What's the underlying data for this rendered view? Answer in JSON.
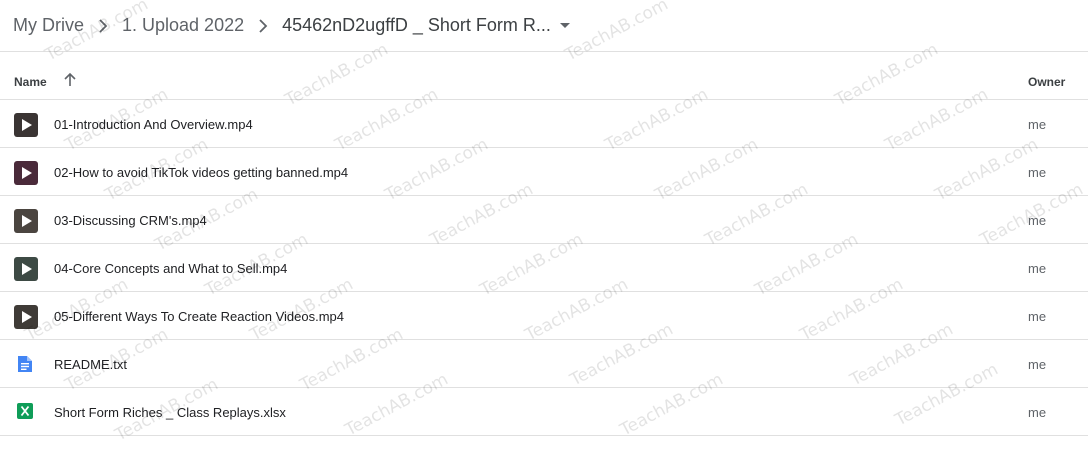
{
  "breadcrumb": {
    "root": "My Drive",
    "level1": "1. Upload 2022",
    "current": "45462nD2ugffD _ Short Form R..."
  },
  "columns": {
    "name": "Name",
    "owner": "Owner"
  },
  "files": [
    {
      "name": "01-Introduction And Overview.mp4",
      "owner": "me",
      "type": "video",
      "thumb_color": "#3a3433"
    },
    {
      "name": "02-How to avoid TikTok videos getting banned.mp4",
      "owner": "me",
      "type": "video",
      "thumb_color": "#4a2a3a"
    },
    {
      "name": "03-Discussing CRM's.mp4",
      "owner": "me",
      "type": "video",
      "thumb_color": "#4b4540"
    },
    {
      "name": "04-Core Concepts and What to Sell.mp4",
      "owner": "me",
      "type": "video",
      "thumb_color": "#3d4a44"
    },
    {
      "name": "05-Different Ways To Create Reaction Videos.mp4",
      "owner": "me",
      "type": "video",
      "thumb_color": "#3f3b37"
    },
    {
      "name": "README.txt",
      "owner": "me",
      "type": "doc",
      "icon_color": "#4285f4"
    },
    {
      "name": "Short Form Riches _ Class Replays.xlsx",
      "owner": "me",
      "type": "sheet",
      "icon_color": "#0f9d58"
    }
  ],
  "watermark": "TeachAB.com"
}
